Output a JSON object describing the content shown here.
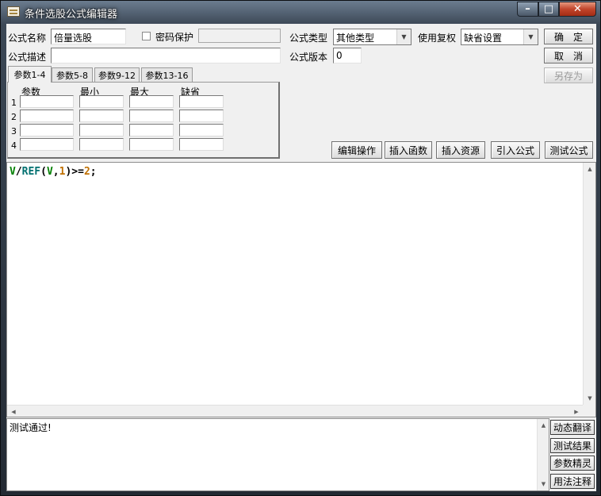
{
  "window": {
    "title": "条件选股公式编辑器"
  },
  "form": {
    "name_label": "公式名称",
    "name_value": "倍量选股",
    "password_label": "密码保护",
    "password_value": "",
    "type_label": "公式类型",
    "type_value": "其他类型",
    "adjust_label": "使用复权",
    "adjust_value": "缺省设置",
    "desc_label": "公式描述",
    "desc_value": "",
    "version_label": "公式版本",
    "version_value": "0"
  },
  "buttons": {
    "ok": "确定",
    "cancel": "取消",
    "save_as": "另存为",
    "edit_ops": "编辑操作",
    "insert_func": "插入函数",
    "insert_resource": "插入资源",
    "import_formula": "引入公式",
    "test_formula": "测试公式"
  },
  "tabs": [
    {
      "label": "参数1-4",
      "active": true
    },
    {
      "label": "参数5-8",
      "active": false
    },
    {
      "label": "参数9-12",
      "active": false
    },
    {
      "label": "参数13-16",
      "active": false
    }
  ],
  "params": {
    "headers": [
      "参数",
      "最小",
      "最大",
      "缺省"
    ],
    "rows": [
      "1",
      "2",
      "3",
      "4"
    ]
  },
  "code": {
    "tokens": [
      {
        "text": "V",
        "color": "#008000"
      },
      {
        "text": "/",
        "color": "#000000"
      },
      {
        "text": "REF",
        "color": "#007070"
      },
      {
        "text": "(",
        "color": "#000000"
      },
      {
        "text": "V",
        "color": "#008000"
      },
      {
        "text": ",",
        "color": "#000000"
      },
      {
        "text": "1",
        "color": "#c07000"
      },
      {
        "text": ")>=",
        "color": "#000000"
      },
      {
        "text": "2",
        "color": "#c07000"
      },
      {
        "text": ";",
        "color": "#000000"
      }
    ]
  },
  "output": {
    "text": "测试通过!"
  },
  "side_buttons": [
    "动态翻译",
    "测试结果",
    "参数精灵",
    "用法注释"
  ]
}
